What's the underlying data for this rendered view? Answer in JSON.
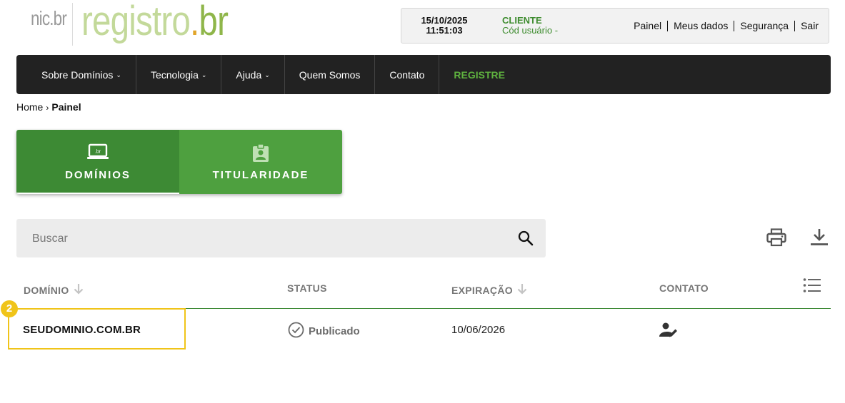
{
  "header": {
    "logo_nic": "nic.br",
    "logo_registro": "registro",
    "logo_dot": ".",
    "logo_br": "br",
    "date": "15/10/2025",
    "time": "11:51:03",
    "user_role": "CLIENTE",
    "user_code": "Cód usuário -",
    "links": [
      "Painel",
      "Meus dados",
      "Segurança",
      "Sair"
    ]
  },
  "nav": {
    "items": [
      {
        "label": "Sobre Domínios",
        "has_dropdown": true
      },
      {
        "label": "Tecnologia",
        "has_dropdown": true
      },
      {
        "label": "Ajuda",
        "has_dropdown": true
      },
      {
        "label": "Quem Somos",
        "has_dropdown": false
      },
      {
        "label": "Contato",
        "has_dropdown": false
      },
      {
        "label": "REGISTRE",
        "has_dropdown": false
      }
    ],
    "chevron": "⌄"
  },
  "breadcrumb": {
    "home": "Home",
    "separator": "›",
    "current": "Painel"
  },
  "tabs": [
    {
      "label": "DOMÍNIOS",
      "icon": "laptop-br-icon",
      "active": true
    },
    {
      "label": "TITULARIDADE",
      "icon": "id-badge-icon",
      "active": false
    }
  ],
  "search": {
    "placeholder": "Buscar",
    "value": ""
  },
  "table": {
    "columns": [
      "DOMÍNIO",
      "STATUS",
      "EXPIRAÇÃO",
      "CONTATO"
    ],
    "rows": [
      {
        "domain": "SEUDOMINIO.COM.BR",
        "status": "Publicado",
        "expiration": "10/06/2026"
      }
    ]
  },
  "annotation": {
    "badge": "2"
  },
  "colors": {
    "brand_green": "#3d8a34",
    "tab_inactive_green": "#4ea03f",
    "nav_bg": "#222222",
    "highlight": "#f0c419",
    "logo_light_green": "#c3d99a"
  }
}
